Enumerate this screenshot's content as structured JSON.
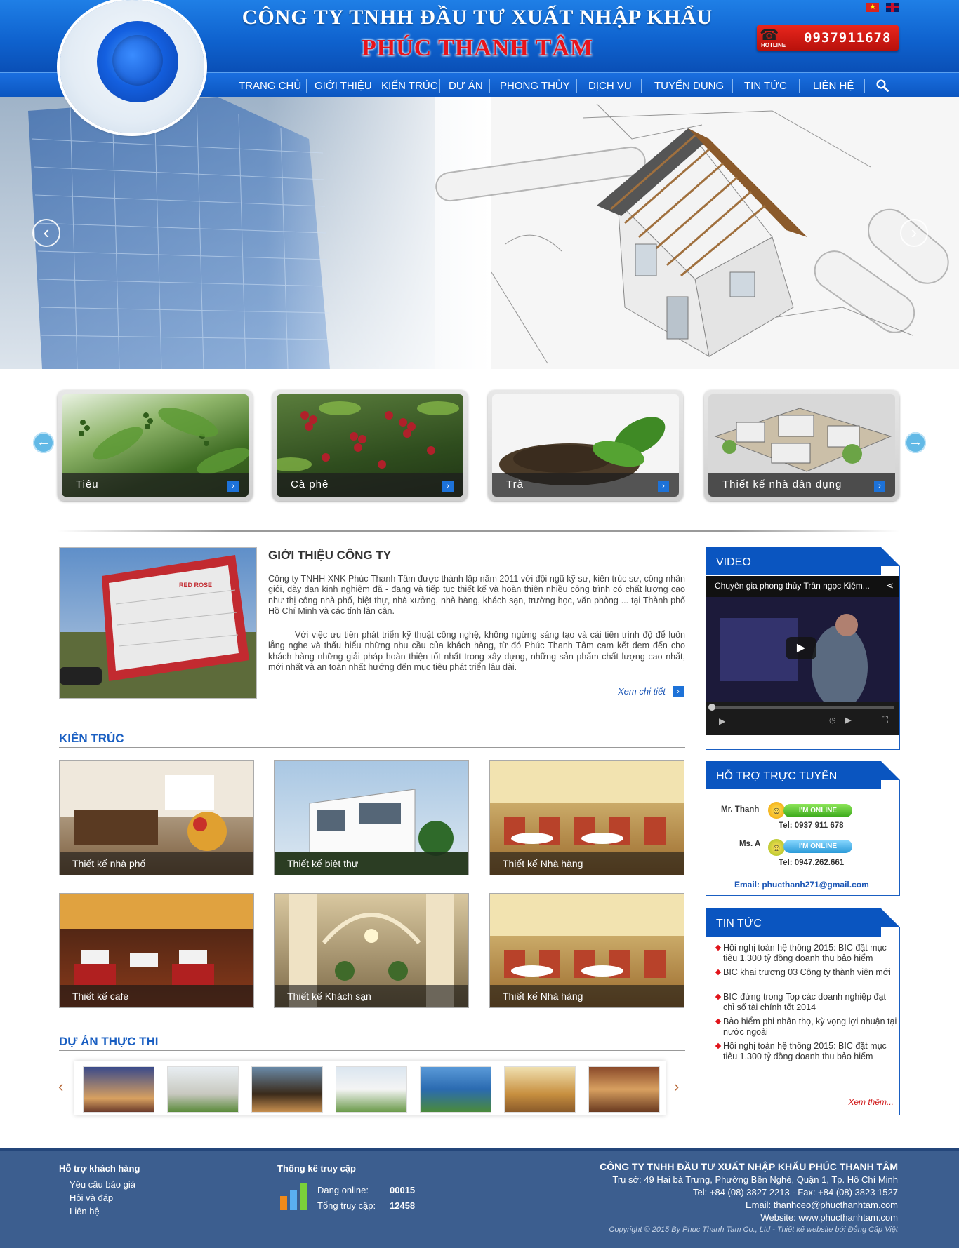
{
  "header": {
    "company_line1": "CÔNG TY TNHH ĐẦU TƯ XUẤT NHẬP KHẨU",
    "company_line2": "PHÚC THANH TÂM",
    "hotline_label": "HOTLINE",
    "hotline_number": "0937911678"
  },
  "nav": [
    "TRANG CHỦ",
    "GIỚI THIỆU",
    "KIẾN TRÚC",
    "DỰ ÁN",
    "PHONG THỦY",
    "DỊCH VỤ",
    "TUYỂN DỤNG",
    "TIN TỨC",
    "LIÊN HỆ"
  ],
  "categories": [
    "Tiêu",
    "Cà phê",
    "Trà",
    "Thiết kế nhà dân dụng"
  ],
  "intro": {
    "title": "GIỚI THIỆU CÔNG TY",
    "p1": "Công ty TNHH XNK Phúc Thanh Tâm được thành lập năm 2011 với đội ngũ kỹ sư, kiến trúc sư, công nhân giỏi, dày dạn kinh nghiệm đã - đang và tiếp tục thiết kế và hoàn thiện nhiều công trình có chất lượng cao như thị công nhà phố, biệt thự, nhà xưởng, nhà hàng, khách sạn, trường học, văn phòng ... tại Thành phố Hồ Chí Minh và các tỉnh lân cận.",
    "p2": "Với việc ưu tiên phát triển kỹ thuật công nghệ, không ngừng sáng tạo và cải tiến trình độ để luôn lắng nghe và thấu hiểu những nhu cầu của khách hàng, từ đó Phúc Thanh Tâm cam kết đem đến cho khách hàng những giải pháp hoàn thiện tốt nhất trong xây dựng, những sản phẩm chất lượng cao nhất, mới nhất và an  toàn nhất hướng đến mục tiêu phát triển lâu dài.",
    "more": "Xem chi tiết",
    "image_sign": "RED ROSE"
  },
  "architecture": {
    "title": "KIẾN TRÚC",
    "items": [
      "Thiết kế nhà phố",
      "Thiết kế biệt thự",
      "Thiết kế Nhà hàng",
      "Thiết kế cafe",
      "Thiết kế Khách sạn",
      "Thiết kế Nhà hàng"
    ]
  },
  "projects": {
    "title": "DỰ ÁN THỰC THI"
  },
  "video": {
    "title": "VIDEO",
    "caption": "Chuyên gia phong thủy Trần ngọc Kiệm..."
  },
  "support": {
    "title": "HỖ TRỢ TRỰC TUYẾN",
    "online_label": "I'M ONLINE",
    "p1_name": "Mr. Thanh",
    "p1_tel": "Tel: 0937 911 678",
    "p2_name": "Ms. A",
    "p2_tel": "Tel: 0947.262.661",
    "email": "Email: phucthanh271@gmail.com"
  },
  "news": {
    "title": "TIN TỨC",
    "items": [
      "Hội nghị toàn hệ thống 2015: BIC đặt mục tiêu 1.300 tỷ đồng doanh thu bảo hiểm",
      "BIC khai trương 03 Công ty thành viên mới",
      "BIC đứng trong Top các doanh nghiệp đạt chỉ số tài chính tốt 2014",
      "Bảo hiểm phi nhân thọ, kỳ vọng lợi nhuận tại nước ngoài",
      "Hội nghị toàn hệ thống 2015: BIC đặt mục tiêu 1.300 tỷ đồng doanh thu bảo hiểm"
    ],
    "more": "Xem thêm..."
  },
  "footer": {
    "support_title": "Hỗ trợ khách hàng",
    "support_links": [
      "Yêu cầu báo giá",
      "Hỏi và đáp",
      "Liên hệ"
    ],
    "stats_title": "Thống kê truy cập",
    "online_label": "Đang online:",
    "online_value": "00015",
    "total_label": "Tổng truy cập:",
    "total_value": "12458",
    "company": "CÔNG TY TNHH ĐẦU TƯ XUẤT NHẬP KHẨU PHÚC THANH TÂM",
    "address": "Trụ sở: 49 Hai bà Trưng, Phường Bến Nghé, Quận 1, Tp. Hồ Chí Minh",
    "phone": "Tel: +84 (08) 3827 2213  -  Fax: +84 (08) 3823 1527",
    "email": "Email: thanhceo@phucthanhtam.com",
    "website": "Website: www.phucthanhtam.com",
    "copyright": "Copyright © 2015 By Phuc Thanh Tam Co., Ltd - Thiết kế website bởi Đẳng Cấp Việt"
  }
}
